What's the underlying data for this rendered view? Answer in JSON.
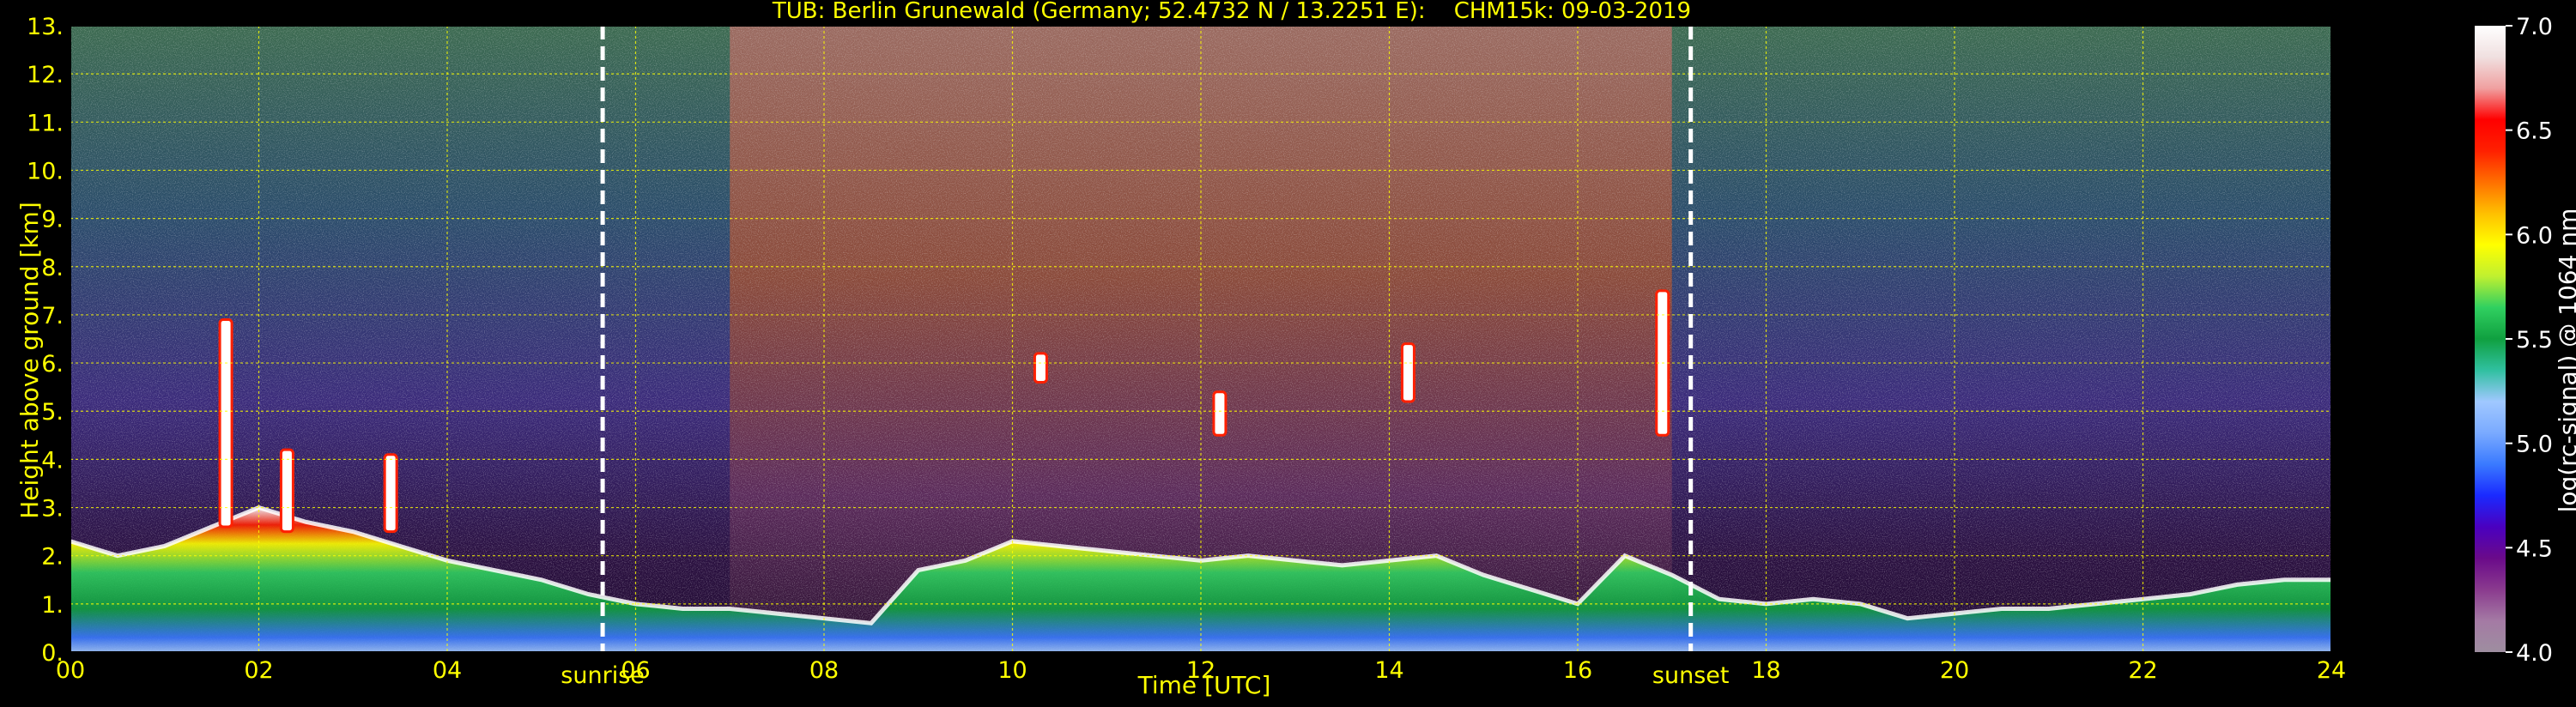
{
  "chart_data": {
    "type": "heatmap",
    "title": "TUB: Berlin Grunewald (Germany; 52.4732 N / 13.2251 E):    CHM15k: 09-03-2019",
    "xlabel": "Time [UTC]",
    "ylabel": "Height above ground [km]",
    "colorbar_label": "log(rc-signal) @ 1064 nm",
    "x_unit": "hours UTC",
    "xlim": [
      0,
      24
    ],
    "ylim": [
      0,
      13
    ],
    "x_ticks": [
      "00",
      "02",
      "04",
      "06",
      "08",
      "10",
      "12",
      "14",
      "16",
      "18",
      "20",
      "22",
      "24"
    ],
    "y_ticks": [
      "0.",
      "1.",
      "2.",
      "3.",
      "4.",
      "5.",
      "6.",
      "7.",
      "8.",
      "9.",
      "10.",
      "11.",
      "12.",
      "13."
    ],
    "colorbar_range": [
      4.0,
      7.0
    ],
    "colorbar_ticks": [
      "4.0",
      "4.5",
      "5.0",
      "5.5",
      "6.0",
      "6.5",
      "7.0"
    ],
    "grid": true,
    "annotations": [
      {
        "label": "sunrise",
        "time": 5.65
      },
      {
        "label": "sunset",
        "time": 17.2
      }
    ],
    "layers": [
      {
        "description_key": "boundary-layer aerosol",
        "start": 0,
        "end": 24
      },
      {
        "description_key": "daytime noise",
        "start": 7.0,
        "end": 17.0
      }
    ],
    "boundary_layer_top_km": [
      [
        0.0,
        2.3
      ],
      [
        0.5,
        2.0
      ],
      [
        1.0,
        2.2
      ],
      [
        1.5,
        2.6
      ],
      [
        2.0,
        3.0
      ],
      [
        2.5,
        2.7
      ],
      [
        3.0,
        2.5
      ],
      [
        3.5,
        2.2
      ],
      [
        4.0,
        1.9
      ],
      [
        4.5,
        1.7
      ],
      [
        5.0,
        1.5
      ],
      [
        5.5,
        1.2
      ],
      [
        6.0,
        1.0
      ],
      [
        6.5,
        0.9
      ],
      [
        7.0,
        0.9
      ],
      [
        7.5,
        0.8
      ],
      [
        8.0,
        0.7
      ],
      [
        8.5,
        0.6
      ],
      [
        9.0,
        1.7
      ],
      [
        9.5,
        1.9
      ],
      [
        10.0,
        2.3
      ],
      [
        10.5,
        2.2
      ],
      [
        11.0,
        2.1
      ],
      [
        11.5,
        2.0
      ],
      [
        12.0,
        1.9
      ],
      [
        12.5,
        2.0
      ],
      [
        13.0,
        1.9
      ],
      [
        13.5,
        1.8
      ],
      [
        14.0,
        1.9
      ],
      [
        14.5,
        2.0
      ],
      [
        15.0,
        1.6
      ],
      [
        15.5,
        1.3
      ],
      [
        16.0,
        1.0
      ],
      [
        16.5,
        2.0
      ],
      [
        17.0,
        1.6
      ],
      [
        17.5,
        1.1
      ],
      [
        18.0,
        1.0
      ],
      [
        18.5,
        1.1
      ],
      [
        19.0,
        1.0
      ],
      [
        19.5,
        0.7
      ],
      [
        20.0,
        0.8
      ],
      [
        20.5,
        0.9
      ],
      [
        21.0,
        0.9
      ],
      [
        21.5,
        1.0
      ],
      [
        22.0,
        1.1
      ],
      [
        22.5,
        1.2
      ],
      [
        23.0,
        1.4
      ],
      [
        23.5,
        1.5
      ],
      [
        24.0,
        1.5
      ]
    ],
    "cloud_features": [
      {
        "time": 1.65,
        "top_km": 6.9,
        "base_km": 2.6
      },
      {
        "time": 2.3,
        "top_km": 4.2,
        "base_km": 2.5
      },
      {
        "time": 3.4,
        "top_km": 4.1,
        "base_km": 2.5
      },
      {
        "time": 10.3,
        "top_km": 6.2,
        "base_km": 5.6
      },
      {
        "time": 12.2,
        "top_km": 5.4,
        "base_km": 4.5
      },
      {
        "time": 14.2,
        "top_km": 6.4,
        "base_km": 5.2
      },
      {
        "time": 16.9,
        "top_km": 7.5,
        "base_km": 4.5
      }
    ]
  },
  "colors": {
    "text": "#ffff00",
    "grid": "#ffff00",
    "background": "#000000",
    "colorbar_stops": [
      "#9e8ea0",
      "#a47aa4",
      "#8a3a8e",
      "#6a0a8a",
      "#4a00c0",
      "#1a2aff",
      "#3a7aff",
      "#7aaaff",
      "#a0c8ff",
      "#30c0a0",
      "#10a040",
      "#30d060",
      "#c0f030",
      "#ffff00",
      "#ffc000",
      "#ff7000",
      "#ff2000",
      "#ff0000",
      "#f0a0a0",
      "#f0e0e0",
      "#ffffff"
    ]
  }
}
